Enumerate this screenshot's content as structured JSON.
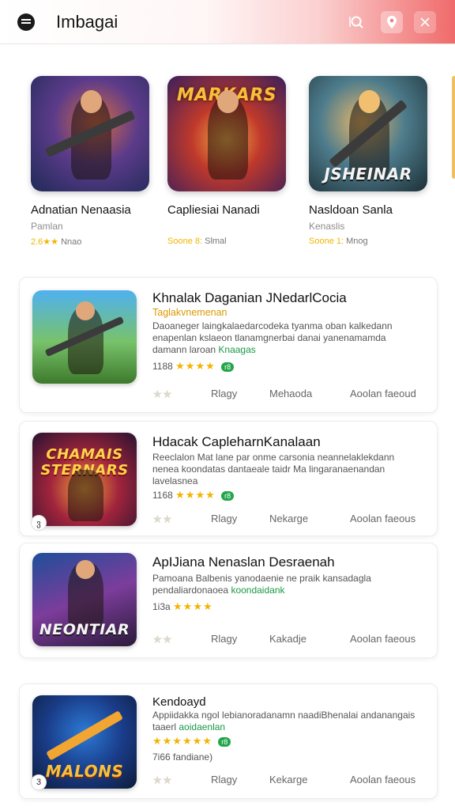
{
  "header": {
    "title": "Imbagai"
  },
  "featured": [
    {
      "title": "Adnatian Nenaasia",
      "subtitle": "Pamlan",
      "meta_score": "2.6★★",
      "meta_text": "Nnao",
      "art_text": ""
    },
    {
      "title": "Capliesiai Nanadi",
      "subtitle": "",
      "meta_score": "Soone 8:",
      "meta_text": "Slmal",
      "art_text": "MARKARS"
    },
    {
      "title": "Nasldoan Sanla",
      "subtitle": "Kenaslis",
      "meta_score": "Soone 1:",
      "meta_text": "Mnog",
      "art_text": "JSHEINAR"
    }
  ],
  "list": [
    {
      "title": "Khnalak Daganian JNedarlCocia",
      "subtitle": "Taglakvnemenan",
      "desc": "Daoaneger laingkalaedarcodeka tyanma oban kalkedann enapenlan kslaeon tlanamgnerbai danai yanenamamda",
      "desc_green_prefix": "damann laroan",
      "desc_green": "Knaagas",
      "rating_count": "1188",
      "rating_stars": "★★★★",
      "badge": "r8",
      "action_stars": "★★",
      "action_stars_dim": "★★",
      "action_1": "Rlagy",
      "action_2": "Mehaoda",
      "action_3": "Aoolan faeoud",
      "art_text": ""
    },
    {
      "title": "Hdacak CapleharnKanalaan",
      "subtitle": "",
      "desc": "Reeclalon Mat lane par onme carsonia neannelaklekdann nenea koondatas dantaeale taidr Ma lingaranaenandan",
      "desc_green_prefix": "lavelasnea",
      "desc_green": "",
      "rating_count": "1168",
      "rating_stars": "★★★★",
      "badge": "r8",
      "action_stars": "★★",
      "action_stars_dim": "★★",
      "action_1": "Rlagy",
      "action_2": "Nekarge",
      "action_3": "Aoolan faeous",
      "art_text": "CHAMAIS STERNARS",
      "badge_round": "ვ"
    },
    {
      "title": "ApIJiana Nenaslan Desraenah",
      "subtitle": "",
      "desc": "Pamoana Balbenis yanodaenie ne praik kansadagla",
      "desc_green_prefix": "pendaliardonaoea",
      "desc_green": "koondaidank",
      "rating_count": "1i3a",
      "rating_stars": "★★★★",
      "badge": "",
      "action_stars": "★★",
      "action_stars_dim": "★★",
      "action_1": "Rlagy",
      "action_2": "Kakadje",
      "action_3": "Aoolan faeous",
      "art_text": "NEONTIAR",
      "badge_round": ""
    },
    {
      "title": "Kendoayd",
      "subtitle": "",
      "desc": "Appiidakka ngol lebianoradanamn naadiBhenalai",
      "desc_green_prefix": "andanangais taaerl",
      "desc_green": "aoidaenlan",
      "rating_count": "7i66 fandiane)",
      "rating_stars": "★★★★★★",
      "badge": "r8",
      "action_stars": "★★",
      "action_stars_dim": "★★",
      "action_1": "Rlagy",
      "action_2": "Kekarge",
      "action_3": "Aoolan faeous",
      "art_text": "MALONS",
      "badge_round": "3"
    }
  ]
}
